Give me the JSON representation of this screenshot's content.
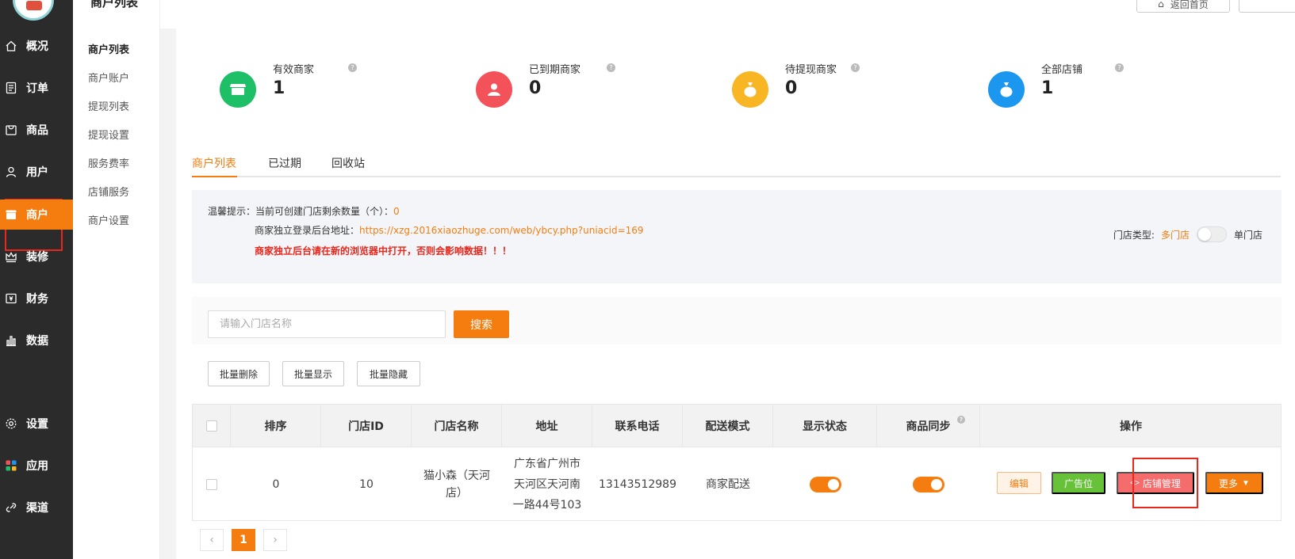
{
  "header": {
    "title": "商户列表",
    "back_home": "返回首页"
  },
  "nav": {
    "items": [
      {
        "label": "概况",
        "icon": "home-icon"
      },
      {
        "label": "订单",
        "icon": "order-icon"
      },
      {
        "label": "商品",
        "icon": "goods-icon"
      },
      {
        "label": "用户",
        "icon": "user-icon"
      },
      {
        "label": "商户",
        "icon": "merchant-icon",
        "active": true
      },
      {
        "label": "装修",
        "icon": "crown-icon"
      },
      {
        "label": "财务",
        "icon": "finance-icon"
      },
      {
        "label": "数据",
        "icon": "chart-icon"
      },
      {
        "label": "设置",
        "icon": "gear-icon"
      },
      {
        "label": "应用",
        "icon": "apps-icon"
      },
      {
        "label": "渠道",
        "icon": "link-icon"
      }
    ]
  },
  "submenu": {
    "items": [
      {
        "label": "商户列表",
        "active": true
      },
      {
        "label": "商户账户"
      },
      {
        "label": "提现列表"
      },
      {
        "label": "提现设置"
      },
      {
        "label": "服务费率"
      },
      {
        "label": "店铺服务"
      },
      {
        "label": "商户设置"
      }
    ]
  },
  "stats": [
    {
      "label": "有效商家",
      "value": "1",
      "color": "#1ec067",
      "icon": "store-icon"
    },
    {
      "label": "已到期商家",
      "value": "0",
      "color": "#f4525a",
      "icon": "person-icon"
    },
    {
      "label": "待提现商家",
      "value": "0",
      "color": "#f9b624",
      "icon": "moneybag-icon"
    },
    {
      "label": "全部店铺",
      "value": "1",
      "color": "#1c97f0",
      "icon": "moneybag-icon"
    }
  ],
  "tabs": [
    {
      "label": "商户列表",
      "active": true
    },
    {
      "label": "已过期"
    },
    {
      "label": "回收站"
    }
  ],
  "notice": {
    "line1_prefix": "温馨提示：当前可创建门店剩余数量（个）：",
    "line1_value": "0",
    "line2_prefix": "商家独立登录后台地址：",
    "line2_url": "https://xzg.2016xiaozhuge.com/web/ybcy.php?uniacid=169",
    "line3_warning": "商家独立后台请在新的浏览器中打开，否则会影响数据！！！",
    "store_type_label": "门店类型:",
    "store_type_multi": "多门店",
    "store_type_single": "单门店"
  },
  "search": {
    "placeholder": "请输入门店名称",
    "button": "搜索"
  },
  "batch": {
    "delete": "批量删除",
    "show": "批量显示",
    "hide": "批量隐藏"
  },
  "table": {
    "headers": {
      "sort": "排序",
      "store_id": "门店ID",
      "store_name": "门店名称",
      "address": "地址",
      "phone": "联系电话",
      "delivery": "配送模式",
      "display": "显示状态",
      "sync": "商品同步",
      "ops": "操作"
    },
    "rows": [
      {
        "sort": "0",
        "store_id": "10",
        "store_name_1": "猫小森（天河",
        "store_name_2": "店）",
        "address_1": "广东省广州市",
        "address_2": "天河区天河南",
        "address_3": "一路44号103",
        "phone": "13143512989",
        "delivery": "商家配送",
        "display_on": true,
        "sync_on": true
      }
    ],
    "ops": {
      "edit": "编辑",
      "ad": "广告位",
      "shop": "店铺管理",
      "more": "更多"
    }
  },
  "pager": {
    "prev": "‹",
    "current": "1",
    "next": "›"
  }
}
